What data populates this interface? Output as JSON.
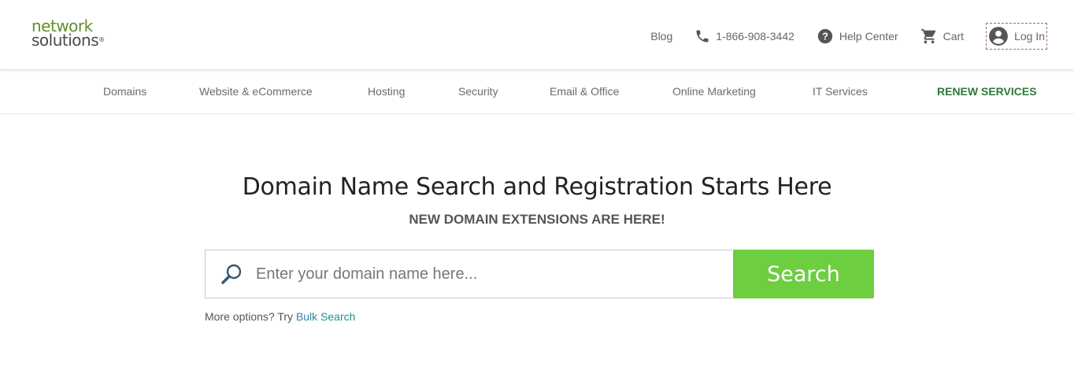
{
  "header": {
    "logo_line1": "network",
    "logo_line2": "solutions",
    "logo_mark": "®",
    "util": {
      "blog": "Blog",
      "phone": "1-866-908-3442",
      "help": "Help Center",
      "cart": "Cart",
      "login": "Log In"
    },
    "icons": [
      "phone-icon",
      "help-icon",
      "cart-icon",
      "user-icon"
    ]
  },
  "nav": {
    "items": [
      "Domains",
      "Website & eCommerce",
      "Hosting",
      "Security",
      "Email & Office",
      "Online Marketing",
      "IT Services"
    ],
    "renew": "RENEW SERVICES"
  },
  "hero": {
    "title": "Domain Name Search and Registration Starts Here",
    "subtitle": "NEW DOMAIN EXTENSIONS ARE HERE!"
  },
  "search": {
    "placeholder": "Enter your domain name here...",
    "value": "",
    "button": "Search",
    "more_text": "More options? Try ",
    "bulk_link": "Bulk Search"
  },
  "colors": {
    "brand_green": "#5f8f2a",
    "search_button": "#6dce3f",
    "renew_green": "#2f7a3a",
    "link": "#2a8a99"
  }
}
